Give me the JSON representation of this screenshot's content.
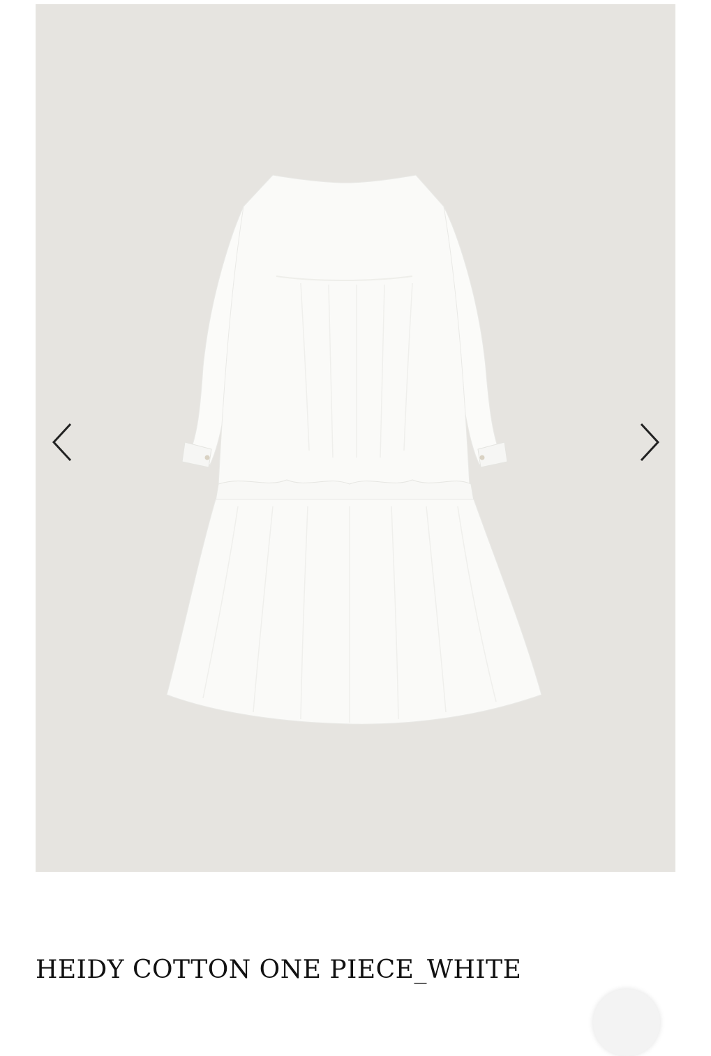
{
  "product": {
    "title": "HEIDY COTTON ONE PIECE_WHITE",
    "image": {
      "alt": "White cotton tiered dress with three-quarter sleeves, back view",
      "background_color": "#e6e4e0",
      "garment_color": "#fafaf8"
    }
  },
  "gallery": {
    "prev_icon": "chevron-left-icon",
    "next_icon": "chevron-right-icon"
  }
}
